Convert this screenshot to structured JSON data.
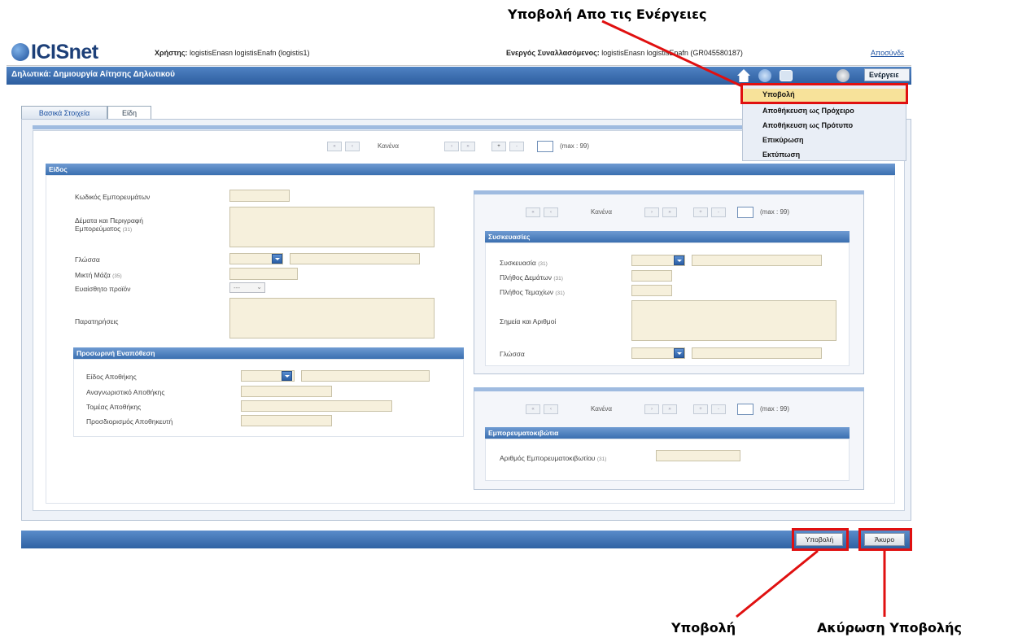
{
  "callouts": {
    "top": "Υποβολή Απο τις Ενέργειες",
    "submit": "Υποβολή",
    "cancel": "Ακύρωση Υποβολής"
  },
  "header": {
    "logo": "ICISnet",
    "user_label": "Χρήστης:",
    "user_value": "logistisEnasn logistisEnafn (logistis1)",
    "active_label": "Ενεργός Συναλλασόμενος:",
    "active_value": "logistisEnasn logistisEnafn (GR045580187)",
    "logout_link": "Αποσύνδε",
    "page_title": "Δηλωτικά: Δημιουργία Αίτησης Δηλωτικού",
    "actions_label": "Ενέργειε"
  },
  "actions_menu": {
    "items": [
      "Υποβολή",
      "Αποθήκευση ως Πρόχειρο",
      "Αποθήκευση ως Πρότυπο",
      "Επικύρωση",
      "Εκτύπωση"
    ]
  },
  "tabs": [
    "Βασικά Στοιχεία",
    "Είδη"
  ],
  "pager": {
    "none_text": "Κανένα",
    "max_text": "(max : 99)"
  },
  "items_section": {
    "title": "Είδος",
    "fields": {
      "commodity_code": "Κωδικός Εμπορευμάτων",
      "description_line1": "Δέματα και Περιγραφή",
      "description_line2": "Εμπορεύματος",
      "description_tag": "(31)",
      "language": "Γλώσσα",
      "gross_mass": "Μικτή Μάζα",
      "gross_mass_tag": "(35)",
      "sensitive_product": "Ευαίσθητο προϊόν",
      "sensitive_value": "---",
      "remarks": "Παρατηρήσεις"
    }
  },
  "temporary_storage": {
    "title": "Προσωρινή Εναπόθεση",
    "fields": [
      "Είδος Αποθήκης",
      "Αναγνωριστικό Αποθήκης",
      "Τομέας Αποθήκης",
      "Προσδιορισμός Αποθηκευτή"
    ]
  },
  "packages": {
    "title": "Συσκευασίες",
    "packaging": "Συσκευασία",
    "packaging_tag": "(31)",
    "num_packages": "Πλήθος Δεμάτων",
    "num_packages_tag": "(31)",
    "num_pieces": "Πλήθος Τεμαχίων",
    "num_pieces_tag": "(31)",
    "marks_numbers": "Σημεία και Αριθμοί",
    "language": "Γλώσσα"
  },
  "containers": {
    "title": "Εμπορευματοκιβώτια",
    "container_number": "Αριθμός Εμπορευματοκιβωτίου",
    "container_number_tag": "(31)"
  },
  "footer": {
    "submit_button": "Υποβολή",
    "cancel_button": "Άκυρο"
  },
  "colors": {
    "accent": "#3a6fb0",
    "field_bg": "#f6f0dc",
    "highlight": "#e01010"
  }
}
